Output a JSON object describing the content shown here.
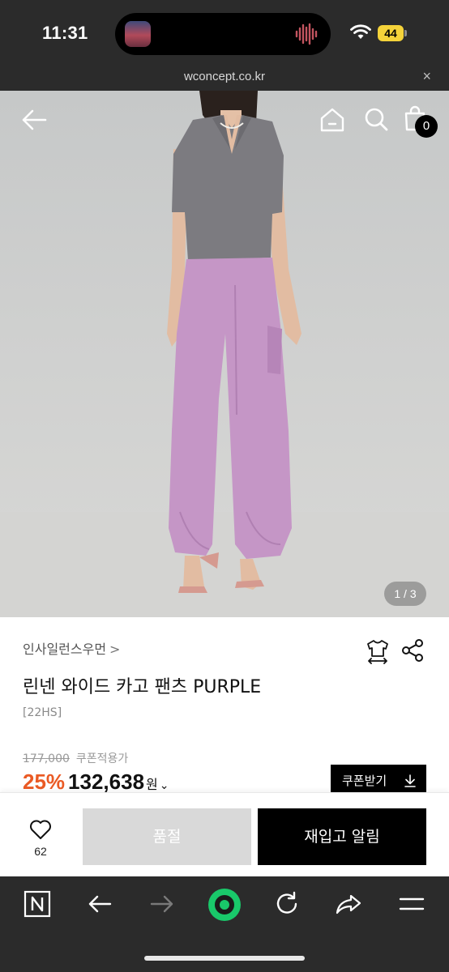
{
  "status_bar": {
    "time": "11:31",
    "battery": "44"
  },
  "browser": {
    "url": "wconcept.co.kr",
    "close_glyph": "×"
  },
  "header": {
    "cart_count": "0"
  },
  "gallery": {
    "counter": "1 / 3"
  },
  "product": {
    "brand": "인사일런스우먼",
    "brand_chevron": ">",
    "name": "린넨 와이드 카고 팬츠 PURPLE",
    "code": "[22HS]",
    "original_price": "177,000",
    "coupon_label": "쿠폰적용가",
    "discount": "25%",
    "price": "132,638",
    "currency": "원",
    "currency_chevron": "⌄",
    "coupon_button": "쿠폰받기"
  },
  "actions": {
    "like_count": "62",
    "soldout_label": "품절",
    "restock_label": "재입고 알림"
  },
  "colors": {
    "discount": "#ea5a24",
    "browser_bg": "#2b2b2b",
    "browser_accent": "#19c86a",
    "battery": "#f5d33a"
  }
}
